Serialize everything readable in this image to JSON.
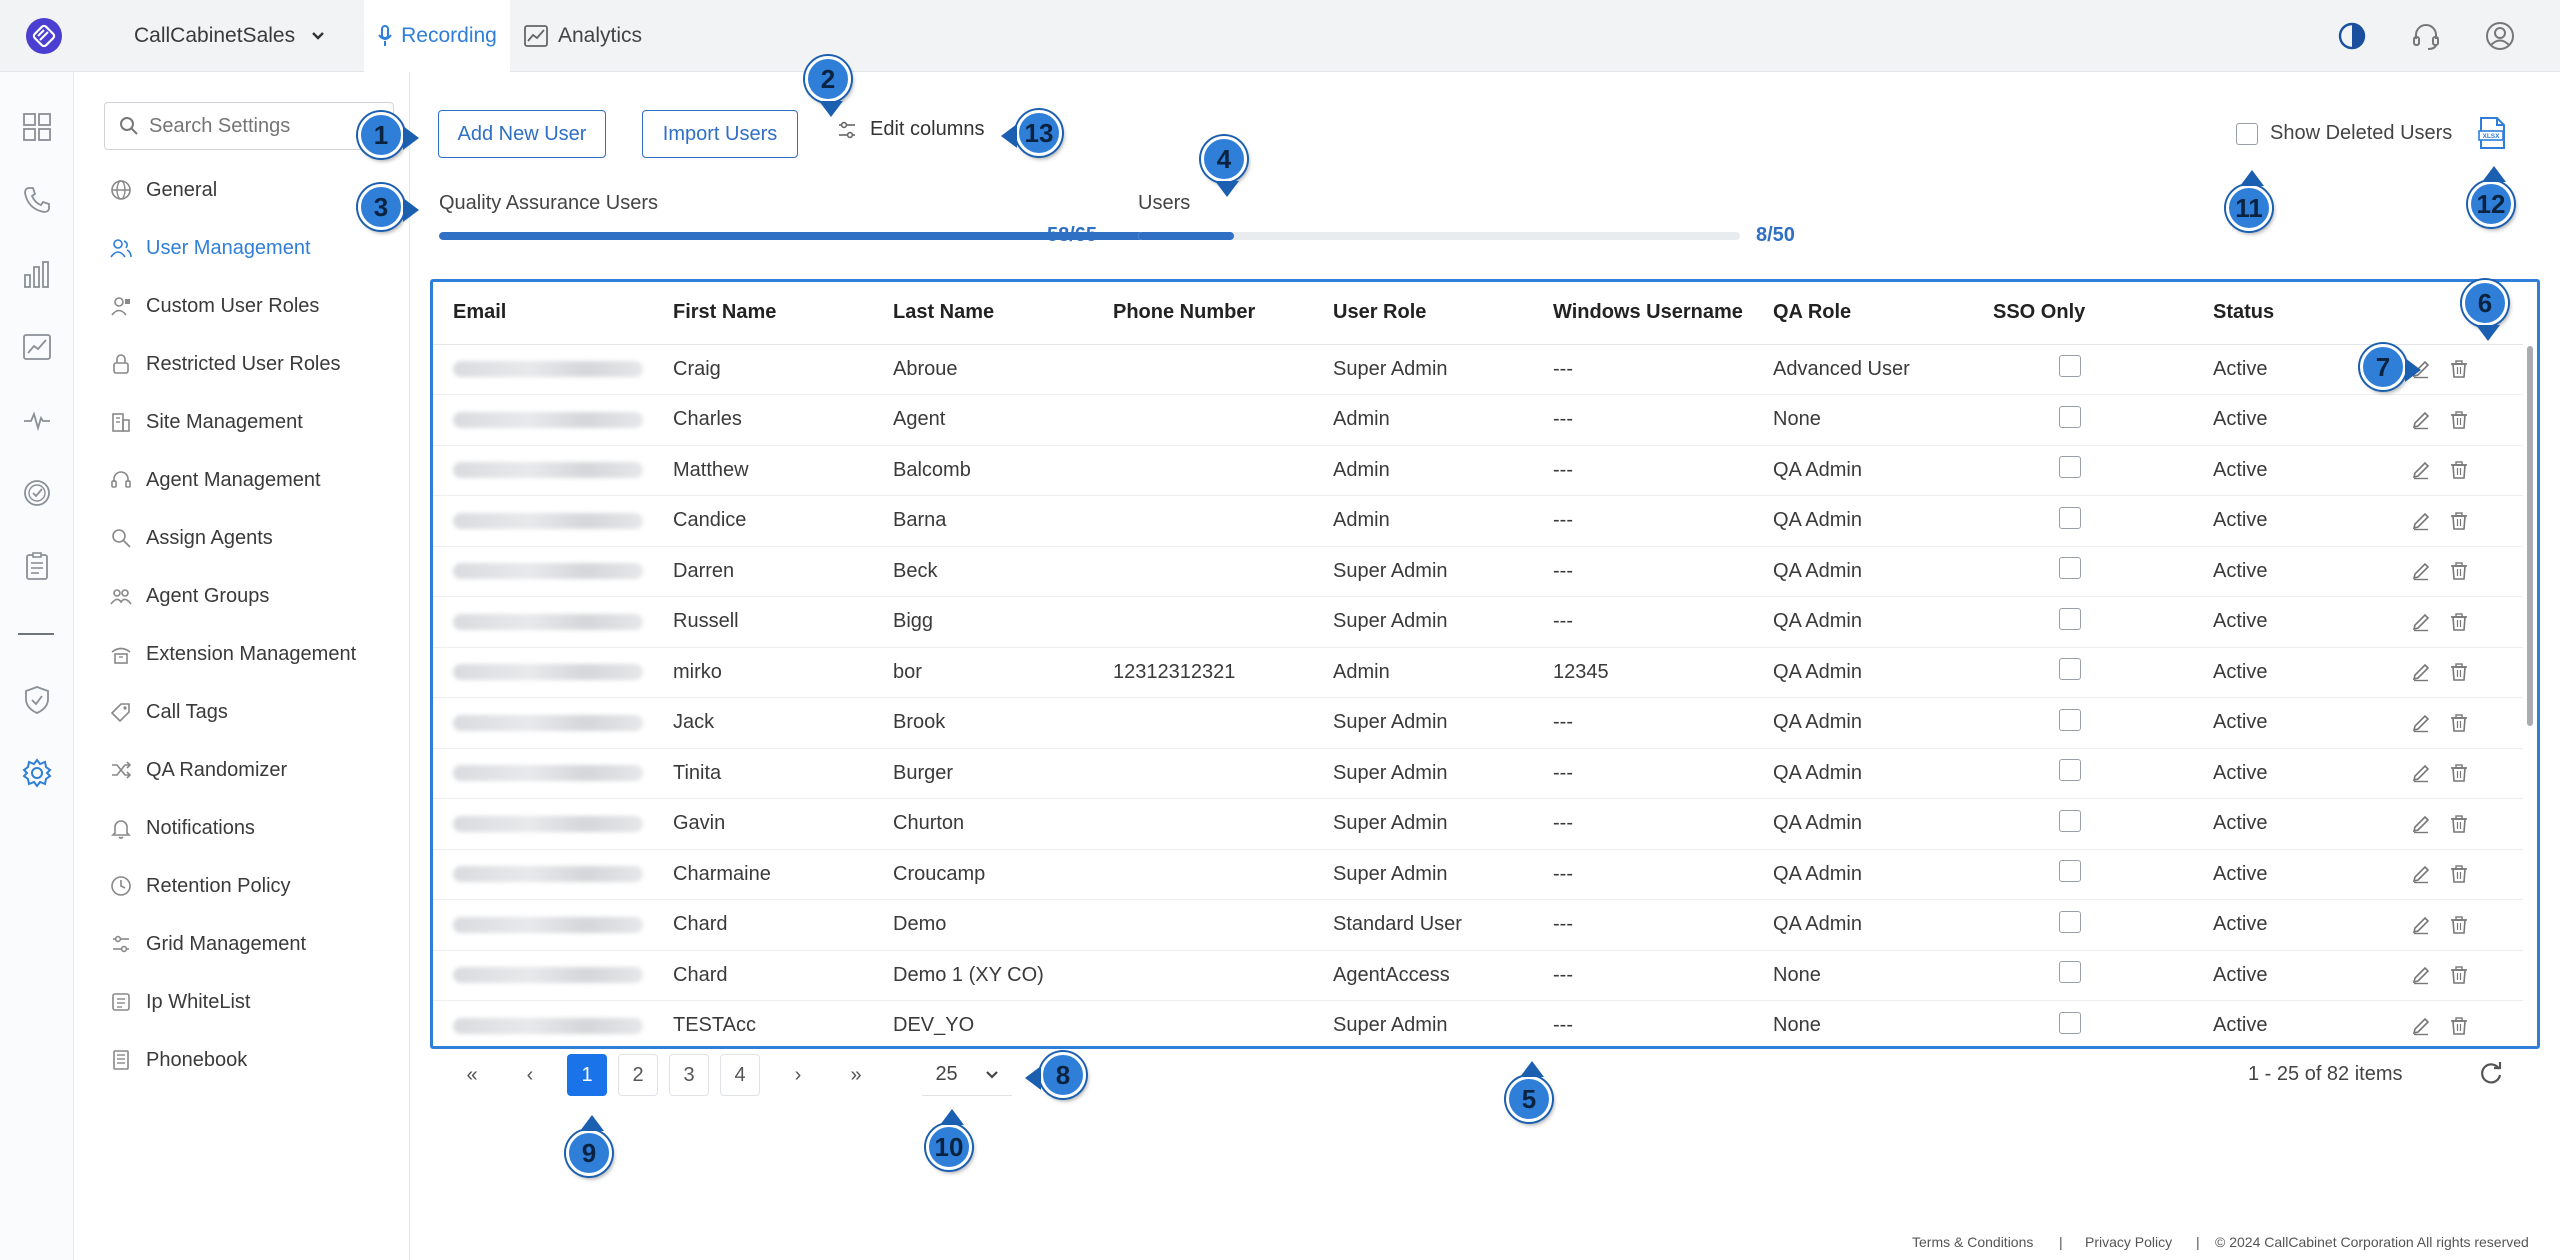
{
  "topbar": {
    "workspace": "CallCabinetSales",
    "tabs": [
      {
        "label": "Recording",
        "icon": "microphone-icon",
        "active": true
      },
      {
        "label": "Analytics",
        "icon": "chart-icon",
        "active": false
      }
    ],
    "right_icons": [
      "contrast-icon",
      "headset-icon",
      "user-icon"
    ],
    "accent_color": "#2f7fd9"
  },
  "rail": {
    "icons": [
      "dashboard-icon",
      "phone-icon",
      "bar-chart-icon",
      "trend-icon",
      "pulse-icon",
      "check-circle-icon",
      "clipboard-icon",
      "shield-icon",
      "settings-icon"
    ]
  },
  "sidebar": {
    "search_placeholder": "Search Settings",
    "items": [
      {
        "label": "General",
        "icon": "globe-icon"
      },
      {
        "label": "User Management",
        "icon": "users-icon",
        "active": true
      },
      {
        "label": "Custom User Roles",
        "icon": "user-role-icon"
      },
      {
        "label": "Restricted User Roles",
        "icon": "lock-icon"
      },
      {
        "label": "Site Management",
        "icon": "building-icon"
      },
      {
        "label": "Agent Management",
        "icon": "headset-icon"
      },
      {
        "label": "Assign Agents",
        "icon": "search-user-icon"
      },
      {
        "label": "Agent Groups",
        "icon": "group-icon"
      },
      {
        "label": "Extension Management",
        "icon": "extension-icon"
      },
      {
        "label": "Call Tags",
        "icon": "tag-icon"
      },
      {
        "label": "QA Randomizer",
        "icon": "shuffle-icon"
      },
      {
        "label": "Notifications",
        "icon": "bell-icon"
      },
      {
        "label": "Retention Policy",
        "icon": "clock-icon"
      },
      {
        "label": "Grid Management",
        "icon": "sliders-icon"
      },
      {
        "label": "Ip WhiteList",
        "icon": "list-icon"
      },
      {
        "label": "Phonebook",
        "icon": "book-icon"
      }
    ]
  },
  "toolbar": {
    "add_user": "Add New User",
    "import_users": "Import Users",
    "edit_columns": "Edit columns",
    "show_deleted": "Show Deleted Users"
  },
  "usage": {
    "qa_label": "Quality Assurance Users",
    "qa_count": "58/65",
    "qa_fraction": 0.892,
    "users_label": "Users",
    "users_count": "8/50",
    "users_fraction": 0.16
  },
  "table": {
    "columns": [
      "Email",
      "First Name",
      "Last Name",
      "Phone Number",
      "User Role",
      "Windows Username",
      "QA Role",
      "SSO Only",
      "Status"
    ],
    "rows": [
      {
        "first": "Craig",
        "last": "Abroue",
        "phone": "",
        "role": "Super Admin",
        "win": "---",
        "qa": "Advanced User",
        "status": "Active"
      },
      {
        "first": "Charles",
        "last": "Agent",
        "phone": "",
        "role": "Admin",
        "win": "---",
        "qa": "None",
        "status": "Active"
      },
      {
        "first": "Matthew",
        "last": "Balcomb",
        "phone": "",
        "role": "Admin",
        "win": "---",
        "qa": "QA Admin",
        "status": "Active"
      },
      {
        "first": "Candice",
        "last": "Barna",
        "phone": "",
        "role": "Admin",
        "win": "---",
        "qa": "QA Admin",
        "status": "Active"
      },
      {
        "first": "Darren",
        "last": "Beck",
        "phone": "",
        "role": "Super Admin",
        "win": "---",
        "qa": "QA Admin",
        "status": "Active"
      },
      {
        "first": "Russell",
        "last": "Bigg",
        "phone": "",
        "role": "Super Admin",
        "win": "---",
        "qa": "QA Admin",
        "status": "Active"
      },
      {
        "first": "mirko",
        "last": "bor",
        "phone": "12312312321",
        "role": "Admin",
        "win": "12345",
        "qa": "QA Admin",
        "status": "Active"
      },
      {
        "first": "Jack",
        "last": "Brook",
        "phone": "",
        "role": "Super Admin",
        "win": "---",
        "qa": "QA Admin",
        "status": "Active"
      },
      {
        "first": "Tinita",
        "last": "Burger",
        "phone": "",
        "role": "Super Admin",
        "win": "---",
        "qa": "QA Admin",
        "status": "Active"
      },
      {
        "first": "Gavin",
        "last": "Churton",
        "phone": "",
        "role": "Super Admin",
        "win": "---",
        "qa": "QA Admin",
        "status": "Active"
      },
      {
        "first": "Charmaine",
        "last": "Croucamp",
        "phone": "",
        "role": "Super Admin",
        "win": "---",
        "qa": "QA Admin",
        "status": "Active"
      },
      {
        "first": "Chard",
        "last": "Demo",
        "phone": "",
        "role": "Standard User",
        "win": "---",
        "qa": "QA Admin",
        "status": "Active"
      },
      {
        "first": "Chard",
        "last": "Demo 1 (XY CO)",
        "phone": "",
        "role": "AgentAccess",
        "win": "---",
        "qa": "None",
        "status": "Active"
      },
      {
        "first": "TESTAcc",
        "last": "DEV_YO",
        "phone": "",
        "role": "Super Admin",
        "win": "---",
        "qa": "None",
        "status": "Active"
      }
    ]
  },
  "pagination": {
    "pages": [
      "1",
      "2",
      "3",
      "4"
    ],
    "current": "1",
    "page_size": "25",
    "info": "1 - 25 of 82 items"
  },
  "footer": {
    "terms": "Terms & Conditions",
    "sep": "|",
    "privacy": "Privacy Policy",
    "copyright": "© 2024 CallCabinet Corporation All rights reserved"
  },
  "callouts": [
    "1",
    "2",
    "3",
    "4",
    "5",
    "6",
    "7",
    "8",
    "9",
    "10",
    "11",
    "12",
    "13"
  ]
}
